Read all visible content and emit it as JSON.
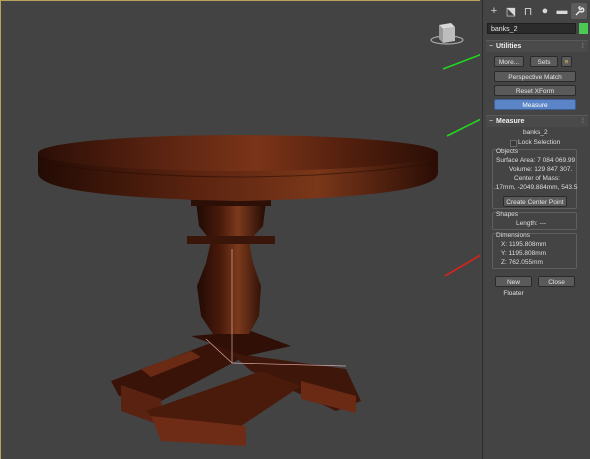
{
  "command_panel": {
    "tabs": [
      {
        "icon": "plus-icon",
        "glyph": "+"
      },
      {
        "icon": "modify-icon",
        "glyph": "⬔"
      },
      {
        "icon": "hierarchy-icon",
        "glyph": "⊓"
      },
      {
        "icon": "motion-icon",
        "glyph": "●"
      },
      {
        "icon": "display-icon",
        "glyph": "▬"
      },
      {
        "icon": "utilities-wrench-icon",
        "glyph": "🔧"
      }
    ],
    "object_name": "banks_2",
    "object_color": "#4cc952"
  },
  "utilities": {
    "title": "Utilities",
    "more_label": "More...",
    "sets_label": "Sets",
    "buttons": [
      "Perspective Match",
      "Reset XForm",
      "Measure"
    ]
  },
  "measure": {
    "title": "Measure",
    "object_name": "banks_2",
    "lock_selection": "Lock Selection",
    "objects_group": "Objects",
    "surface_area": "Surface Area: 7 084 069.99",
    "volume": "Volume:  129 847 307.",
    "center_of_mass_label": "Center of Mass:",
    "center_of_mass_value": ".17mm, -2049.884mm, 543.5",
    "create_center_point": "Create Center Point",
    "shapes_group": "Shapes",
    "length": "Length: ---",
    "dimensions_group": "Dimensions",
    "dim_x": "X:   1195.808mm",
    "dim_y": "Y:   1195.808mm",
    "dim_z": "Z:   762.055mm",
    "new_floater": "New Floater",
    "close": "Close"
  },
  "colors": {
    "arrow_green": "#22d61f",
    "arrow_red": "#d8241d",
    "wood_dark": "#3b1408",
    "wood_mid": "#6b2812",
    "highlight_button": "#5b85c6"
  }
}
